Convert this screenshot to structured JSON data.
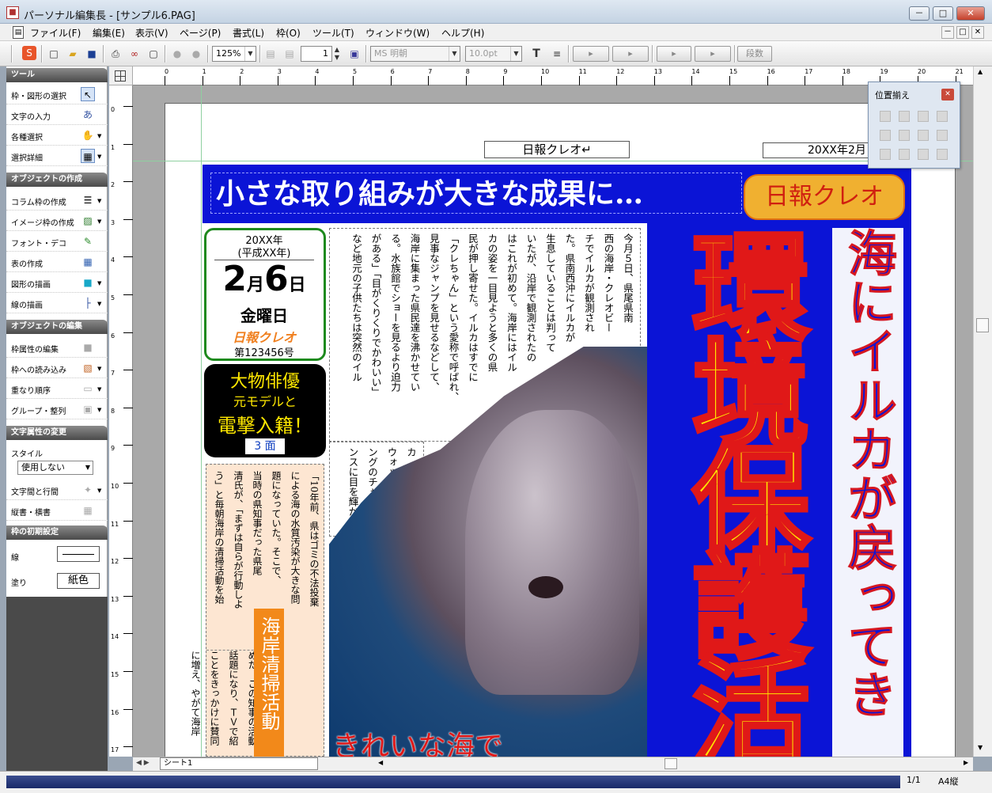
{
  "window": {
    "title": "パーソナル編集長 - [サンプル6.PAG]",
    "buttons": [
      "－",
      "□",
      "✕"
    ]
  },
  "menu": [
    "ファイル(F)",
    "編集(E)",
    "表示(V)",
    "ページ(P)",
    "書式(L)",
    "枠(O)",
    "ツール(T)",
    "ウィンドウ(W)",
    "ヘルプ(H)"
  ],
  "toolbar": {
    "zoom": "125%",
    "page_num": "1",
    "font": "MS 明朝",
    "size": "10.0pt",
    "bold": "T",
    "columns": "段数"
  },
  "panel": {
    "tools": {
      "header": "ツール",
      "items": [
        "枠・図形の選択",
        "文字の入力",
        "各種選択",
        "選択詳細"
      ]
    },
    "create": {
      "header": "オブジェクトの作成",
      "items": [
        "コラム枠の作成",
        "イメージ枠の作成",
        "フォント・デコ",
        "表の作成",
        "図形の描画",
        "線の描画"
      ]
    },
    "edit": {
      "header": "オブジェクトの編集",
      "items": [
        "枠属性の編集",
        "枠への読み込み",
        "重なり順序",
        "グループ・整列"
      ]
    },
    "text": {
      "header": "文字属性の変更",
      "style_label": "スタイル",
      "style_value": "使用しない",
      "items": [
        "文字間と行間",
        "縦書・横書"
      ]
    },
    "frame": {
      "header": "枠の初期設定",
      "line_label": "線",
      "fill_label": "塗り",
      "fill_value": "紙色"
    }
  },
  "ruler": {
    "h": [
      "0",
      "1",
      "2",
      "3",
      "4",
      "5",
      "6",
      "7",
      "8",
      "9",
      "10",
      "11",
      "12",
      "13",
      "14",
      "15",
      "16",
      "17",
      "18",
      "19",
      "20",
      "21"
    ],
    "v": [
      "0",
      "1",
      "2",
      "3",
      "4",
      "5",
      "6",
      "7",
      "8",
      "9",
      "10",
      "11",
      "12",
      "13",
      "14",
      "15",
      "16",
      "17"
    ]
  },
  "document": {
    "header_name": "日報クレオ",
    "header_date": "20XX年2月",
    "headline": "小さな取り組みが大きな成果に…",
    "logo": "日報クレオ",
    "date_box": {
      "line1": "20XX年",
      "line2": "(平成XX年)",
      "month": "2",
      "month_unit": "月",
      "day": "6",
      "day_unit": "日",
      "weekday": "金曜日",
      "paper": "日報クレオ",
      "issue": "第123456号"
    },
    "ad": {
      "line1": "大物俳優",
      "line2": "元モデルと",
      "line3": "電撃入籍！",
      "page": "3 面"
    },
    "big_title": "環境保護活",
    "side_title": "海にイルカが戻ってき",
    "article_cols": [
      "今月５日、県尾県南",
      "西の海岸・クレオビー",
      "チでイルカが観測され",
      "た。県南西沖にイルカが",
      "生息していることは判って",
      "いたが、沿岸で観測されたの",
      "はこれが初めて。海岸にはイル",
      "カの姿を一目見ようと多くの県",
      "民が押し寄せた。イルカはすでに",
      "「クレちゃん」という愛称で呼ばれ、",
      "見事なジャンプを見せるなどして、",
      "海岸に集まった県民達を沸かせてい",
      "る。水族館でショーを見るより迫力",
      "がある」「目がくりくりでかわいい」",
      "など地元の子供たちは突然のイル"
    ],
    "article2_cols": [
      "カ",
      "ウォッチ",
      "ングのチャ",
      "ンスに目を輝かせ"
    ],
    "left_cols": [
      "「10年前、県はゴミの不法投棄",
      "による海の水質汚染が大きな問",
      "題になっていた。そこで、",
      "当時の県知事だった県尾",
      "清氏が、「まずは自らが行動しよ",
      "う」と毎朝海岸の清掃活動を始"
    ],
    "left_cols2": [
      "めた。この知事の活動",
      "話題になり、ＴＶで紹",
      "ことをきっかけに賛同",
      "に増え、やがて海岸"
    ],
    "box_title": "海岸清掃活動",
    "bottom_text": "きれいな海で"
  },
  "sheet_tab": "シート1",
  "status": {
    "page": "1/1",
    "paper": "A4縦"
  },
  "align_panel": {
    "title": "位置揃え",
    "close": "✕"
  },
  "colors": {
    "blue": "#0b14d6",
    "red": "#e01818",
    "yellow": "#ffe800",
    "green": "#1e8a1e",
    "box_fill": "#fde6d2",
    "box_title_fill": "#f2891a"
  }
}
